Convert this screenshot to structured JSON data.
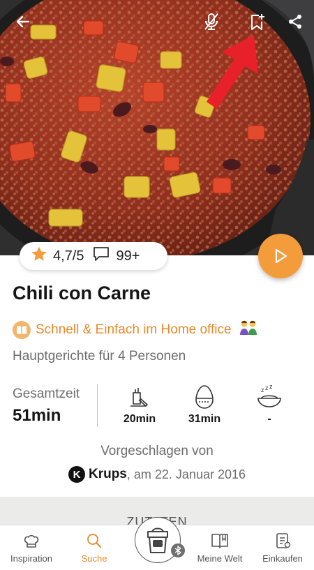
{
  "colors": {
    "accent": "#f39c3c",
    "accent_text": "#e8892a",
    "highlight_arrow": "#e8202a",
    "muted_text": "#6d6d6d"
  },
  "header": {
    "icons": [
      "back-arrow-icon",
      "mic-off-icon",
      "bookmark-add-icon",
      "share-icon"
    ]
  },
  "recipe": {
    "rating": "4,7/5",
    "comments": "99+",
    "title": "Chili con Carne",
    "collection": "Schnell & Einfach im Home office",
    "category": "Hauptgerichte für 4 Personen",
    "total_time_label": "Gesamtzeit",
    "total_time": "51min",
    "prep_time": "20min",
    "cook_time": "31min",
    "rest_time": "-",
    "suggested_label": "Vorgeschlagen von",
    "author_initial": "K",
    "author": "Krups",
    "date": ", am 22. Januar 2016",
    "ingredients_label": "ZUTATEN"
  },
  "nav": {
    "items": [
      {
        "label": "Inspiration",
        "icon": "chef-hat-icon"
      },
      {
        "label": "Suche",
        "icon": "search-icon",
        "active": true
      },
      {
        "label": "",
        "icon": "thermomix-device-icon"
      },
      {
        "label": "Meine Welt",
        "icon": "book-icon"
      },
      {
        "label": "Einkaufen",
        "icon": "shopping-list-icon"
      }
    ]
  }
}
